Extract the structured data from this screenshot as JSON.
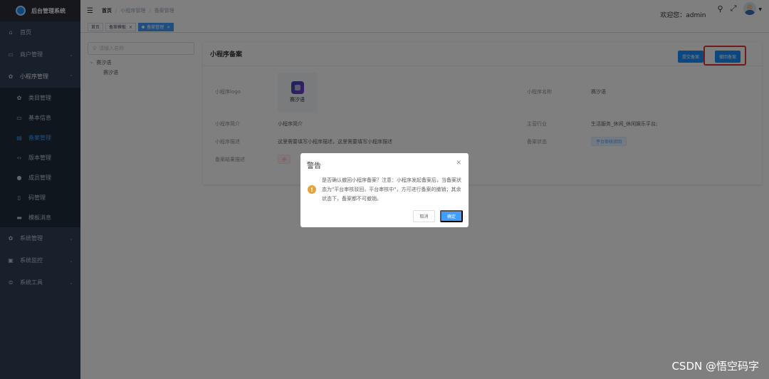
{
  "sidebar": {
    "logo_text": "后台管理系统",
    "items": [
      {
        "label": "首页",
        "icon": "home-icon"
      },
      {
        "label": "商户管理",
        "icon": "store-icon"
      },
      {
        "label": "小程序管理",
        "icon": "app-icon"
      },
      {
        "label": "类目管理",
        "icon": "category-icon"
      },
      {
        "label": "基本信息",
        "icon": "info-icon"
      },
      {
        "label": "备案管理",
        "icon": "record-icon"
      },
      {
        "label": "版本管理",
        "icon": "code-icon"
      },
      {
        "label": "成员管理",
        "icon": "user-icon"
      },
      {
        "label": "码管理",
        "icon": "qrcode-icon"
      },
      {
        "label": "模板消息",
        "icon": "message-icon"
      },
      {
        "label": "系统管理",
        "icon": "settings-icon"
      },
      {
        "label": "系统监控",
        "icon": "monitor-icon"
      },
      {
        "label": "系统工具",
        "icon": "tool-icon"
      }
    ]
  },
  "navbar": {
    "breadcrumb": [
      "首页",
      "小程序管理",
      "备案管理"
    ],
    "welcome": "欢迎您：admin"
  },
  "tags": [
    {
      "label": "首页"
    },
    {
      "label": "备案模板"
    },
    {
      "label": "备案管理"
    }
  ],
  "tree": {
    "placeholder": "请输入名称",
    "root": "赛汐语",
    "child": "赛汐语"
  },
  "card": {
    "title": "小程序备案",
    "submit_label": "提交备案",
    "withdraw_label": "撤回备案",
    "rows": {
      "logo_label": "小程序logo",
      "logo_name": "赛汐语",
      "name_label": "小程序名称",
      "name_value": "赛汐语",
      "intro_label": "小程序简介",
      "intro_value": "小程序简介",
      "industry_label": "主营行业",
      "industry_value": "生活服务_休闲_休闲娱乐平台;",
      "desc_label": "小程序描述",
      "desc_value": "这里需要填写小程序描述，这里需要填写小程序描述",
      "status_label": "备案状态",
      "status_value": "平台审核驳回",
      "result_label": "备案结果描述",
      "result_value": "小"
    }
  },
  "dialog": {
    "title": "警告",
    "message": "是否确认撤回小程序备案？注意：小程序发起备案后，当备案状态为\"平台审核驳回，平台审核中\"，方可进行备案的撤销；其余状态下，备案都不可撤销。",
    "cancel_label": "取消",
    "confirm_label": "确定"
  },
  "watermark": "CSDN @悟空码字",
  "colors": {
    "primary": "#1890ff",
    "sidebar_bg": "#304156",
    "warning": "#e6a23c",
    "highlight": "#e53935"
  }
}
